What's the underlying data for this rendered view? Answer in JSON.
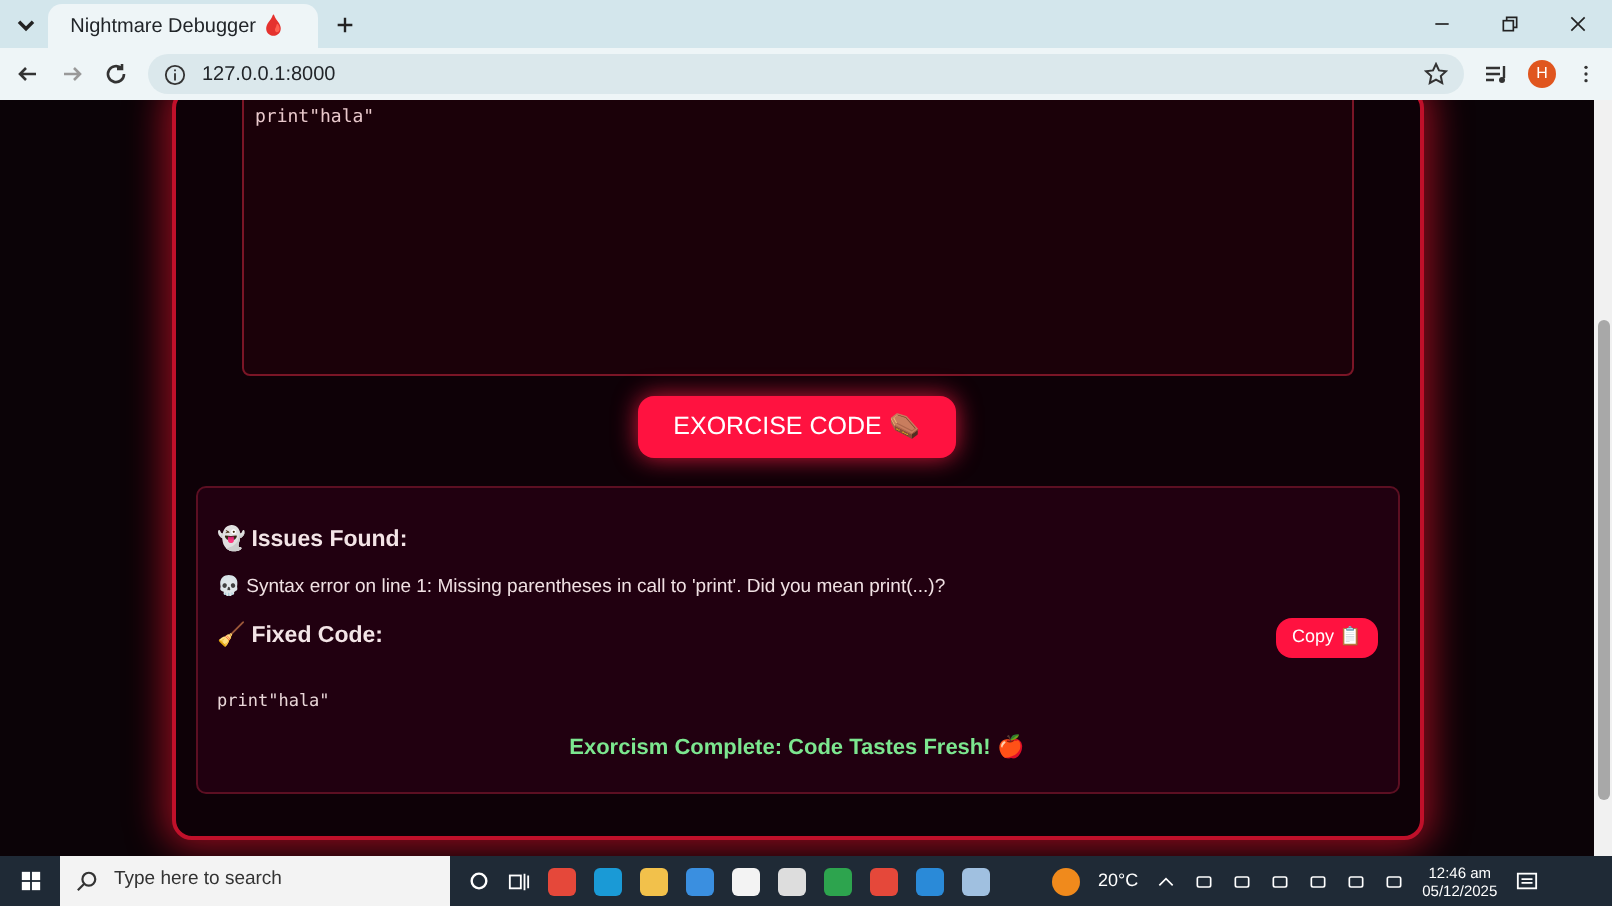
{
  "browser": {
    "tab": {
      "title": "Nightmare Debugger 🩸",
      "selected": true
    },
    "url": "127.0.0.1:8000",
    "avatar": "H"
  },
  "editor": {
    "code": "print\"hala\""
  },
  "exorcise_button": "EXORCISE CODE ⚰️",
  "results": {
    "issues_heading": "👻 Issues Found:",
    "issues": [
      "💀 Syntax error on line 1: Missing parentheses in call to 'print'. Did you mean print(...)?"
    ],
    "fixed_heading": "🧹 Fixed Code:",
    "copy_button": "Copy 📋",
    "fixed_code": "print\"hala\"",
    "success": "Exorcism Complete: Code Tastes Fresh! 🍎"
  },
  "taskbar": {
    "search_placeholder": "Type here to search",
    "temperature": "20°C",
    "time": "12:46 am",
    "date": "05/12/2025"
  }
}
